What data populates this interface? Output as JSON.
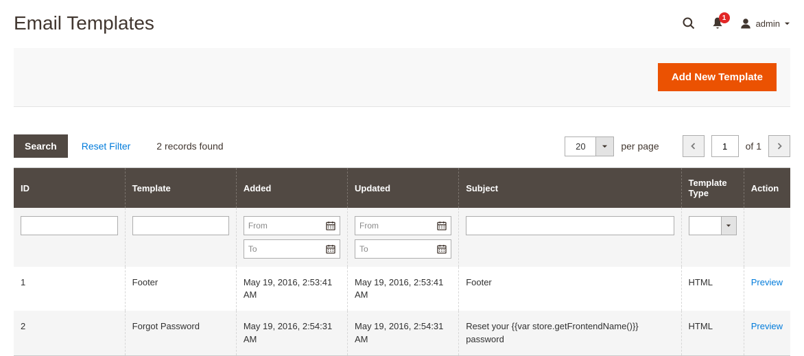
{
  "header": {
    "title": "Email Templates",
    "notifications": "1",
    "user": "admin"
  },
  "actions": {
    "add_template": "Add New Template"
  },
  "toolbar": {
    "search": "Search",
    "reset": "Reset Filter",
    "records": "2 records found",
    "per_page_value": "20",
    "per_page_label": "per page",
    "page_input": "1",
    "page_of": "of 1"
  },
  "columns": {
    "id": "ID",
    "template": "Template",
    "added": "Added",
    "updated": "Updated",
    "subject": "Subject",
    "type": "Template Type",
    "action": "Action"
  },
  "filters": {
    "from": "From",
    "to": "To"
  },
  "rows": [
    {
      "id": "1",
      "template": "Footer",
      "added": "May 19, 2016, 2:53:41 AM",
      "updated": "May 19, 2016, 2:53:41 AM",
      "subject": "Footer",
      "type": "HTML",
      "action": "Preview"
    },
    {
      "id": "2",
      "template": "Forgot Password",
      "added": "May 19, 2016, 2:54:31 AM",
      "updated": "May 19, 2016, 2:54:31 AM",
      "subject": "Reset your {{var store.getFrontendName()}} password",
      "type": "HTML",
      "action": "Preview"
    }
  ]
}
